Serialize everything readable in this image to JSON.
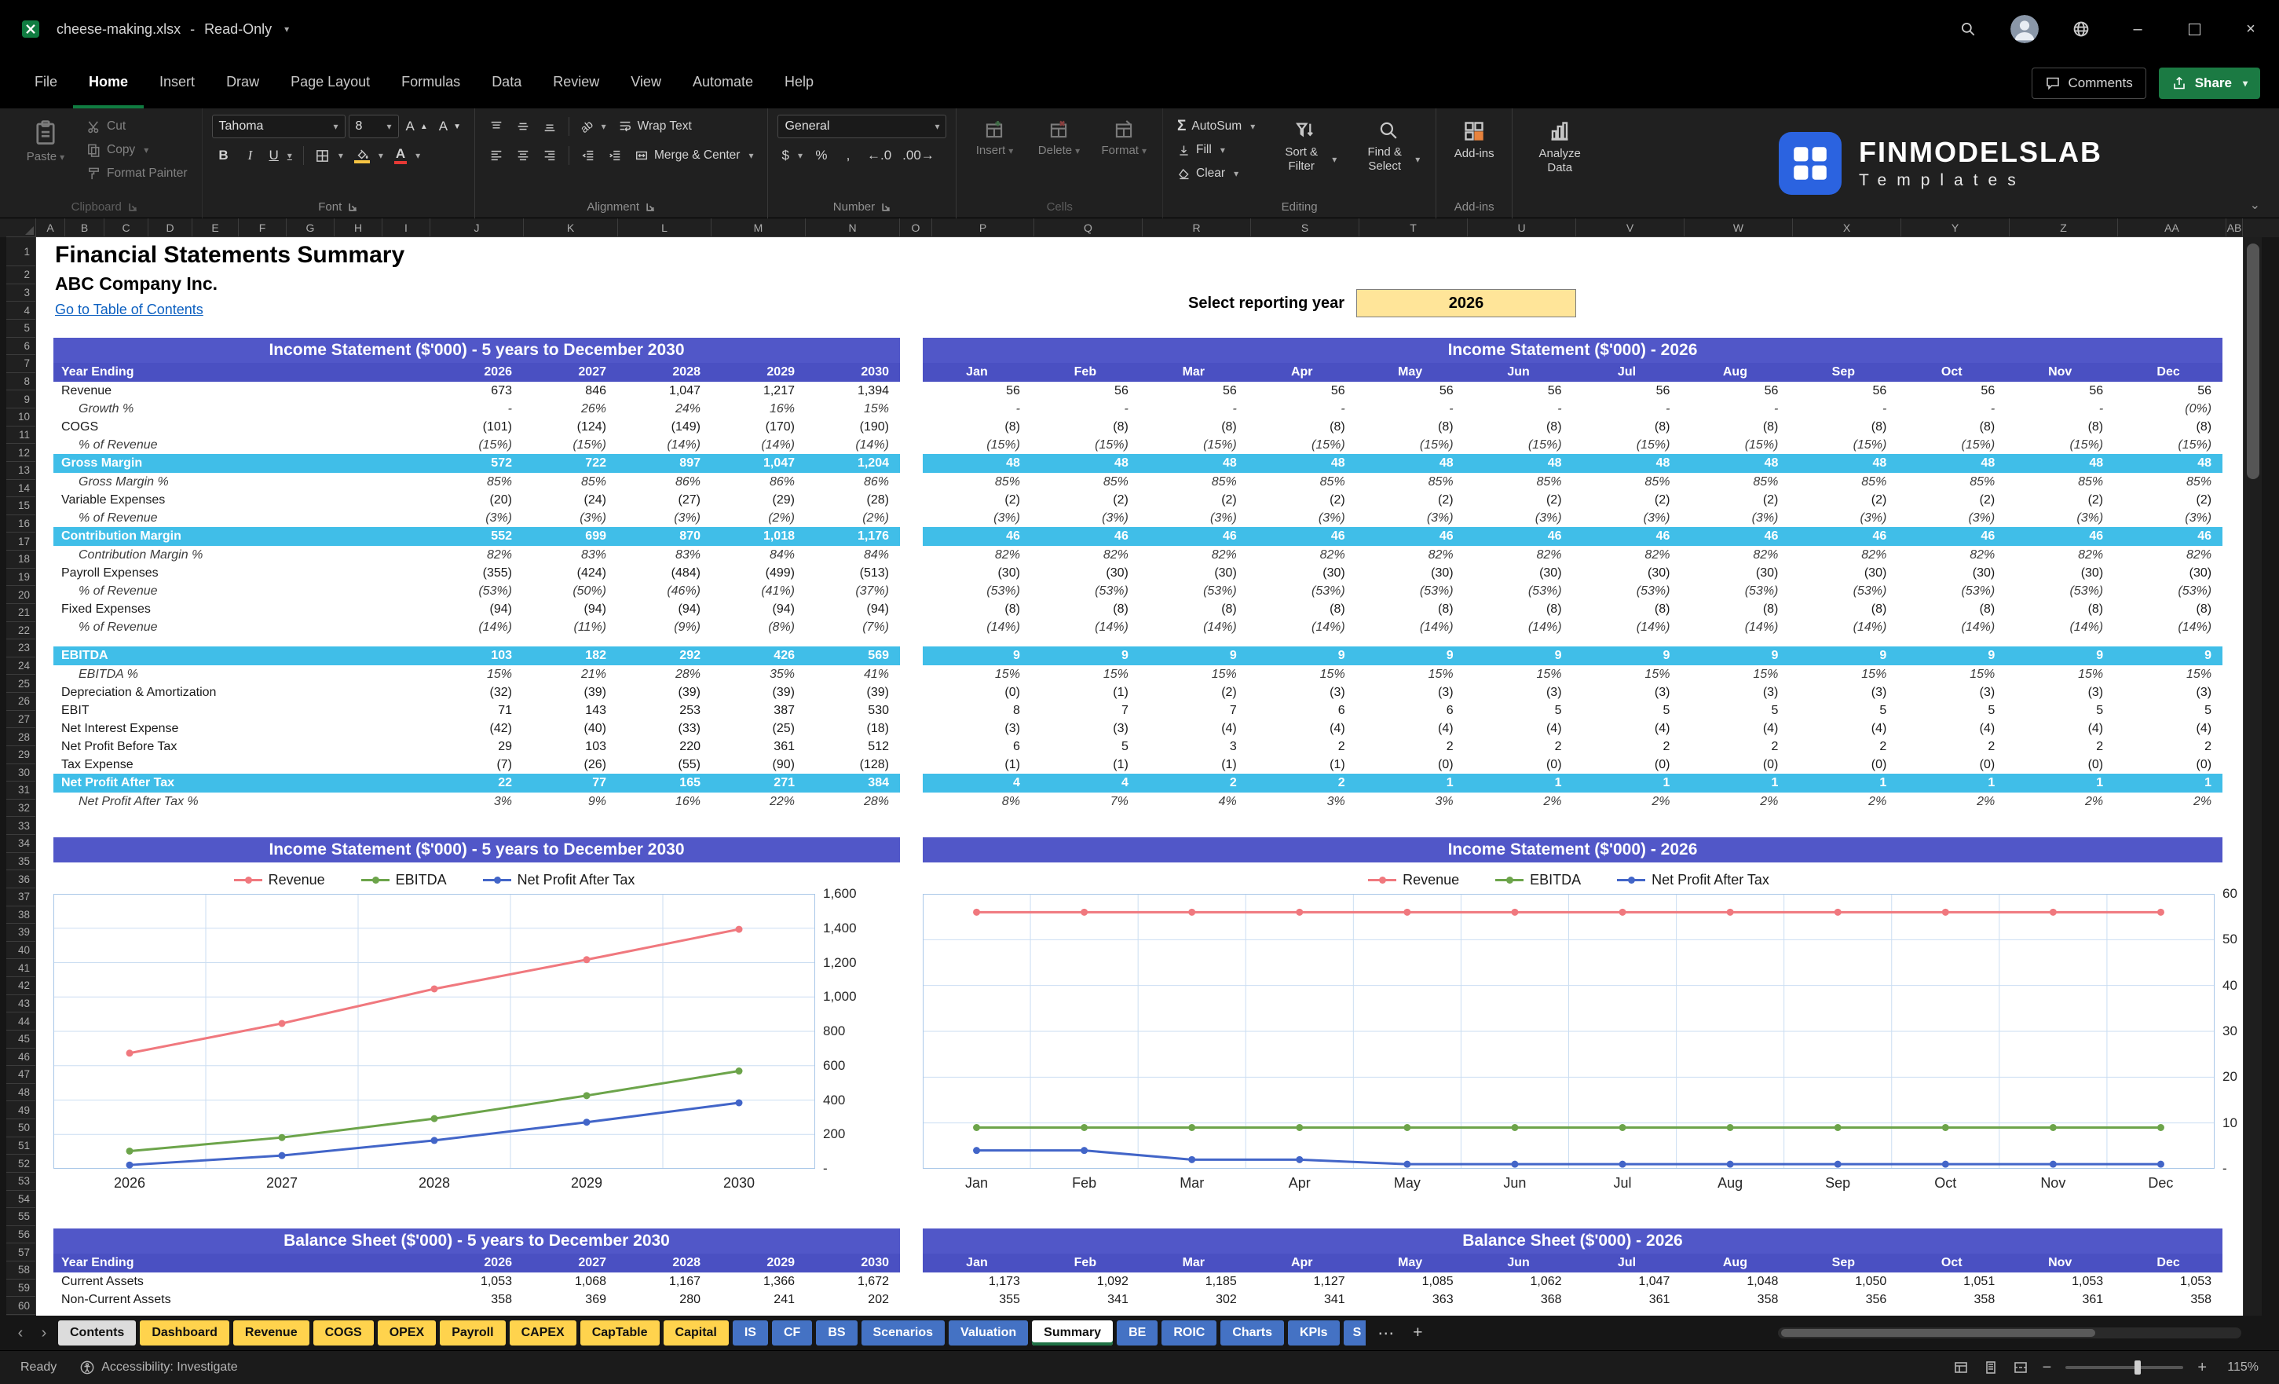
{
  "window": {
    "filename": "cheese-making.xlsx",
    "separator": "-",
    "mode": "Read-Only"
  },
  "menu": {
    "tabs": [
      "File",
      "Home",
      "Insert",
      "Draw",
      "Page Layout",
      "Formulas",
      "Data",
      "Review",
      "View",
      "Automate",
      "Help"
    ],
    "active_tab": "Home",
    "comments": "Comments",
    "share": "Share"
  },
  "ribbon": {
    "font_name": "Tahoma",
    "font_size": "8",
    "number_format": "General",
    "clipboard": {
      "label": "Clipboard",
      "paste": "Paste",
      "cut": "Cut",
      "copy": "Copy",
      "format_painter": "Format Painter"
    },
    "font": {
      "label": "Font",
      "bold": "B",
      "italic": "I",
      "underline": "U",
      "letter": "A",
      "orientation": "ab"
    },
    "alignment": {
      "label": "Alignment",
      "wrap_text": "Wrap Text",
      "merge_center": "Merge & Center"
    },
    "number": {
      "label": "Number",
      "currency": "$",
      "percent": "%",
      "comma": ",",
      "increase_decimal_icon": "←.0",
      "decrease_decimal_icon": ".00→"
    },
    "cells": {
      "label": "Cells",
      "insert": "Insert",
      "delete": "Delete",
      "format": "Format"
    },
    "editing": {
      "label": "Editing",
      "autosum_icon": "Σ",
      "autosum": "AutoSum",
      "fill": "Fill",
      "clear": "Clear",
      "sort_filter": "Sort & Filter",
      "find_select": "Find & Select"
    },
    "addins": {
      "label": "Add-ins",
      "addins": "Add-ins",
      "analyze": "Analyze Data"
    }
  },
  "logo": {
    "title": "FINMODELSLAB",
    "subtitle": "Templates"
  },
  "sheet": {
    "columns": [
      "A",
      "B",
      "C",
      "D",
      "E",
      "F",
      "G",
      "H",
      "I",
      "J",
      "K",
      "L",
      "M",
      "N",
      "O",
      "P",
      "Q",
      "R",
      "S",
      "T",
      "U",
      "V",
      "W",
      "X",
      "Y",
      "Z",
      "AA",
      "AB"
    ],
    "row_count": 60
  },
  "header_area": {
    "title": "Financial Statements Summary",
    "company": "ABC Company Inc.",
    "toc_link": "Go to Table of Contents",
    "select_label": "Select reporting year",
    "selected_year": "2026"
  },
  "colors": {
    "header_purple": "#5157C8",
    "row_header_purple": "#4A50C2",
    "highlight_cyan": "#40BEE8",
    "input_yellow": "#FFE599",
    "tab_yellow": "#FFD34D",
    "tab_blue": "#4472C4",
    "link_blue": "#0B5FC0",
    "share_green": "#1B7A43"
  },
  "income_annual": {
    "title": "Income Statement ($'000) - 5 years to December 2030",
    "header": [
      "Year Ending",
      "2026",
      "2027",
      "2028",
      "2029",
      "2030"
    ],
    "rows": [
      {
        "label": "Revenue",
        "style": "n",
        "values": [
          "673",
          "846",
          "1,047",
          "1,217",
          "1,394"
        ]
      },
      {
        "label": "Growth %",
        "style": "p",
        "values": [
          "-",
          "26%",
          "24%",
          "16%",
          "15%"
        ]
      },
      {
        "label": "COGS",
        "style": "n",
        "values": [
          "(101)",
          "(124)",
          "(149)",
          "(170)",
          "(190)"
        ]
      },
      {
        "label": "% of Revenue",
        "style": "p",
        "values": [
          "(15%)",
          "(15%)",
          "(14%)",
          "(14%)",
          "(14%)"
        ]
      },
      {
        "label": "Gross Margin",
        "style": "h",
        "values": [
          "572",
          "722",
          "897",
          "1,047",
          "1,204"
        ]
      },
      {
        "label": "Gross Margin %",
        "style": "p",
        "values": [
          "85%",
          "85%",
          "86%",
          "86%",
          "86%"
        ]
      },
      {
        "label": "Variable Expenses",
        "style": "n",
        "values": [
          "(20)",
          "(24)",
          "(27)",
          "(29)",
          "(28)"
        ]
      },
      {
        "label": "% of Revenue",
        "style": "p",
        "values": [
          "(3%)",
          "(3%)",
          "(3%)",
          "(2%)",
          "(2%)"
        ]
      },
      {
        "label": "Contribution Margin",
        "style": "h",
        "values": [
          "552",
          "699",
          "870",
          "1,018",
          "1,176"
        ]
      },
      {
        "label": "Contribution Margin %",
        "style": "p",
        "values": [
          "82%",
          "83%",
          "83%",
          "84%",
          "84%"
        ]
      },
      {
        "label": "Payroll Expenses",
        "style": "n",
        "values": [
          "(355)",
          "(424)",
          "(484)",
          "(499)",
          "(513)"
        ]
      },
      {
        "label": "% of Revenue",
        "style": "p",
        "values": [
          "(53%)",
          "(50%)",
          "(46%)",
          "(41%)",
          "(37%)"
        ]
      },
      {
        "label": "Fixed Expenses",
        "style": "n",
        "values": [
          "(94)",
          "(94)",
          "(94)",
          "(94)",
          "(94)"
        ]
      },
      {
        "label": "% of Revenue",
        "style": "p",
        "values": [
          "(14%)",
          "(11%)",
          "(9%)",
          "(8%)",
          "(7%)"
        ]
      },
      {
        "style": "s",
        "values": []
      },
      {
        "label": "EBITDA",
        "style": "h",
        "values": [
          "103",
          "182",
          "292",
          "426",
          "569"
        ]
      },
      {
        "label": "EBITDA %",
        "style": "p",
        "values": [
          "15%",
          "21%",
          "28%",
          "35%",
          "41%"
        ]
      },
      {
        "label": "Depreciation & Amortization",
        "style": "n",
        "values": [
          "(32)",
          "(39)",
          "(39)",
          "(39)",
          "(39)"
        ]
      },
      {
        "label": "EBIT",
        "style": "n",
        "values": [
          "71",
          "143",
          "253",
          "387",
          "530"
        ]
      },
      {
        "label": "Net Interest Expense",
        "style": "n",
        "values": [
          "(42)",
          "(40)",
          "(33)",
          "(25)",
          "(18)"
        ]
      },
      {
        "label": "Net Profit Before Tax",
        "style": "n",
        "values": [
          "29",
          "103",
          "220",
          "361",
          "512"
        ]
      },
      {
        "label": "Tax Expense",
        "style": "n",
        "values": [
          "(7)",
          "(26)",
          "(55)",
          "(90)",
          "(128)"
        ]
      },
      {
        "label": "Net Profit After Tax",
        "style": "h",
        "values": [
          "22",
          "77",
          "165",
          "271",
          "384"
        ]
      },
      {
        "label": "Net Profit After Tax %",
        "style": "p",
        "values": [
          "3%",
          "9%",
          "16%",
          "22%",
          "28%"
        ]
      }
    ]
  },
  "income_monthly": {
    "title": "Income Statement ($'000) - 2026",
    "columns": [
      "Jan",
      "Feb",
      "Mar",
      "Apr",
      "May",
      "Jun",
      "Jul",
      "Aug",
      "Sep",
      "Oct",
      "Nov",
      "Dec"
    ],
    "rows": [
      {
        "style": "n",
        "values": [
          "56",
          "56",
          "56",
          "56",
          "56",
          "56",
          "56",
          "56",
          "56",
          "56",
          "56",
          "56"
        ]
      },
      {
        "style": "p",
        "values": [
          "-",
          "-",
          "-",
          "-",
          "-",
          "-",
          "-",
          "-",
          "-",
          "-",
          "-",
          "(0%)"
        ]
      },
      {
        "style": "n",
        "values": [
          "(8)",
          "(8)",
          "(8)",
          "(8)",
          "(8)",
          "(8)",
          "(8)",
          "(8)",
          "(8)",
          "(8)",
          "(8)",
          "(8)"
        ]
      },
      {
        "style": "p",
        "values": [
          "(15%)",
          "(15%)",
          "(15%)",
          "(15%)",
          "(15%)",
          "(15%)",
          "(15%)",
          "(15%)",
          "(15%)",
          "(15%)",
          "(15%)",
          "(15%)"
        ]
      },
      {
        "style": "h",
        "values": [
          "48",
          "48",
          "48",
          "48",
          "48",
          "48",
          "48",
          "48",
          "48",
          "48",
          "48",
          "48"
        ]
      },
      {
        "style": "p",
        "values": [
          "85%",
          "85%",
          "85%",
          "85%",
          "85%",
          "85%",
          "85%",
          "85%",
          "85%",
          "85%",
          "85%",
          "85%"
        ]
      },
      {
        "style": "n",
        "values": [
          "(2)",
          "(2)",
          "(2)",
          "(2)",
          "(2)",
          "(2)",
          "(2)",
          "(2)",
          "(2)",
          "(2)",
          "(2)",
          "(2)"
        ]
      },
      {
        "style": "p",
        "values": [
          "(3%)",
          "(3%)",
          "(3%)",
          "(3%)",
          "(3%)",
          "(3%)",
          "(3%)",
          "(3%)",
          "(3%)",
          "(3%)",
          "(3%)",
          "(3%)"
        ]
      },
      {
        "style": "h",
        "values": [
          "46",
          "46",
          "46",
          "46",
          "46",
          "46",
          "46",
          "46",
          "46",
          "46",
          "46",
          "46"
        ]
      },
      {
        "style": "p",
        "values": [
          "82%",
          "82%",
          "82%",
          "82%",
          "82%",
          "82%",
          "82%",
          "82%",
          "82%",
          "82%",
          "82%",
          "82%"
        ]
      },
      {
        "style": "n",
        "values": [
          "(30)",
          "(30)",
          "(30)",
          "(30)",
          "(30)",
          "(30)",
          "(30)",
          "(30)",
          "(30)",
          "(30)",
          "(30)",
          "(30)"
        ]
      },
      {
        "style": "p",
        "values": [
          "(53%)",
          "(53%)",
          "(53%)",
          "(53%)",
          "(53%)",
          "(53%)",
          "(53%)",
          "(53%)",
          "(53%)",
          "(53%)",
          "(53%)",
          "(53%)"
        ]
      },
      {
        "style": "n",
        "values": [
          "(8)",
          "(8)",
          "(8)",
          "(8)",
          "(8)",
          "(8)",
          "(8)",
          "(8)",
          "(8)",
          "(8)",
          "(8)",
          "(8)"
        ]
      },
      {
        "style": "p",
        "values": [
          "(14%)",
          "(14%)",
          "(14%)",
          "(14%)",
          "(14%)",
          "(14%)",
          "(14%)",
          "(14%)",
          "(14%)",
          "(14%)",
          "(14%)",
          "(14%)"
        ]
      },
      {
        "style": "s",
        "values": []
      },
      {
        "style": "h",
        "values": [
          "9",
          "9",
          "9",
          "9",
          "9",
          "9",
          "9",
          "9",
          "9",
          "9",
          "9",
          "9"
        ]
      },
      {
        "style": "p",
        "values": [
          "15%",
          "15%",
          "15%",
          "15%",
          "15%",
          "15%",
          "15%",
          "15%",
          "15%",
          "15%",
          "15%",
          "15%"
        ]
      },
      {
        "style": "n",
        "values": [
          "(0)",
          "(1)",
          "(2)",
          "(3)",
          "(3)",
          "(3)",
          "(3)",
          "(3)",
          "(3)",
          "(3)",
          "(3)",
          "(3)"
        ]
      },
      {
        "style": "n",
        "values": [
          "8",
          "7",
          "7",
          "6",
          "6",
          "5",
          "5",
          "5",
          "5",
          "5",
          "5",
          "5"
        ]
      },
      {
        "style": "n",
        "values": [
          "(3)",
          "(3)",
          "(4)",
          "(4)",
          "(4)",
          "(4)",
          "(4)",
          "(4)",
          "(4)",
          "(4)",
          "(4)",
          "(4)"
        ]
      },
      {
        "style": "n",
        "values": [
          "6",
          "5",
          "3",
          "2",
          "2",
          "2",
          "2",
          "2",
          "2",
          "2",
          "2",
          "2"
        ]
      },
      {
        "style": "n",
        "values": [
          "(1)",
          "(1)",
          "(1)",
          "(1)",
          "(0)",
          "(0)",
          "(0)",
          "(0)",
          "(0)",
          "(0)",
          "(0)",
          "(0)"
        ]
      },
      {
        "style": "h",
        "values": [
          "4",
          "4",
          "2",
          "2",
          "1",
          "1",
          "1",
          "1",
          "1",
          "1",
          "1",
          "1"
        ]
      },
      {
        "style": "p",
        "values": [
          "8%",
          "7%",
          "4%",
          "3%",
          "3%",
          "2%",
          "2%",
          "2%",
          "2%",
          "2%",
          "2%",
          "2%"
        ]
      }
    ]
  },
  "balance_annual": {
    "title": "Balance Sheet ($'000) - 5 years to December 2030",
    "header": [
      "Year Ending",
      "2026",
      "2027",
      "2028",
      "2029",
      "2030"
    ],
    "rows": [
      {
        "label": "Current Assets",
        "style": "n",
        "values": [
          "1,053",
          "1,068",
          "1,167",
          "1,366",
          "1,672"
        ]
      },
      {
        "label": "Non-Current Assets",
        "style": "n",
        "values": [
          "358",
          "369",
          "280",
          "241",
          "202"
        ]
      }
    ]
  },
  "balance_monthly": {
    "title": "Balance Sheet ($'000) - 2026",
    "columns": [
      "Jan",
      "Feb",
      "Mar",
      "Apr",
      "May",
      "Jun",
      "Jul",
      "Aug",
      "Sep",
      "Oct",
      "Nov",
      "Dec"
    ],
    "rows": [
      {
        "style": "n",
        "values": [
          "1,173",
          "1,092",
          "1,185",
          "1,127",
          "1,085",
          "1,062",
          "1,047",
          "1,048",
          "1,050",
          "1,051",
          "1,053",
          "1,053"
        ]
      },
      {
        "style": "n",
        "values": [
          "355",
          "341",
          "302",
          "341",
          "363",
          "368",
          "361",
          "358",
          "356",
          "358",
          "361",
          "358"
        ]
      }
    ]
  },
  "chart_data": [
    {
      "type": "line",
      "title": "Income Statement ($'000) - 5 years to December 2030",
      "x": [
        "2026",
        "2027",
        "2028",
        "2029",
        "2030"
      ],
      "series": [
        {
          "name": "Revenue",
          "color": "#F0787E",
          "values": [
            673,
            846,
            1047,
            1217,
            1394
          ]
        },
        {
          "name": "EBITDA",
          "color": "#6CA44A",
          "values": [
            103,
            182,
            292,
            426,
            569
          ]
        },
        {
          "name": "Net Profit After Tax",
          "color": "#4265C8",
          "values": [
            22,
            77,
            165,
            271,
            384
          ]
        }
      ],
      "ylim": [
        0,
        1600
      ],
      "yticks": [
        "1,600",
        "1,400",
        "1,200",
        "1,000",
        "800",
        "600",
        "400",
        "200",
        "-"
      ],
      "legend_position": "top",
      "grid": true
    },
    {
      "type": "line",
      "title": "Income Statement ($'000) - 2026",
      "x": [
        "Jan",
        "Feb",
        "Mar",
        "Apr",
        "May",
        "Jun",
        "Jul",
        "Aug",
        "Sep",
        "Oct",
        "Nov",
        "Dec"
      ],
      "series": [
        {
          "name": "Revenue",
          "color": "#F0787E",
          "values": [
            56,
            56,
            56,
            56,
            56,
            56,
            56,
            56,
            56,
            56,
            56,
            56
          ]
        },
        {
          "name": "EBITDA",
          "color": "#6CA44A",
          "values": [
            9,
            9,
            9,
            9,
            9,
            9,
            9,
            9,
            9,
            9,
            9,
            9
          ]
        },
        {
          "name": "Net Profit After Tax",
          "color": "#4265C8",
          "values": [
            4,
            4,
            2,
            2,
            1,
            1,
            1,
            1,
            1,
            1,
            1,
            1
          ]
        }
      ],
      "ylim": [
        0,
        60
      ],
      "yticks": [
        "60",
        "50",
        "40",
        "30",
        "20",
        "10",
        "-"
      ],
      "legend_position": "top",
      "grid": true
    }
  ],
  "sheet_tabs": [
    {
      "label": "Contents",
      "style": "neutral"
    },
    {
      "label": "Dashboard",
      "style": "yellow"
    },
    {
      "label": "Revenue",
      "style": "yellow"
    },
    {
      "label": "COGS",
      "style": "yellow"
    },
    {
      "label": "OPEX",
      "style": "yellow"
    },
    {
      "label": "Payroll",
      "style": "yellow"
    },
    {
      "label": "CAPEX",
      "style": "yellow"
    },
    {
      "label": "CapTable",
      "style": "yellow"
    },
    {
      "label": "Capital",
      "style": "yellow"
    },
    {
      "label": "IS",
      "style": "blue"
    },
    {
      "label": "CF",
      "style": "blue"
    },
    {
      "label": "BS",
      "style": "blue"
    },
    {
      "label": "Scenarios",
      "style": "blue"
    },
    {
      "label": "Valuation",
      "style": "blue"
    },
    {
      "label": "Summary",
      "style": "active"
    },
    {
      "label": "BE",
      "style": "blue"
    },
    {
      "label": "ROIC",
      "style": "blue"
    },
    {
      "label": "Charts",
      "style": "blue"
    },
    {
      "label": "KPIs",
      "style": "blue"
    },
    {
      "label": "S",
      "style": "blue cut"
    }
  ],
  "status": {
    "ready": "Ready",
    "accessibility": "Accessibility: Investigate",
    "zoom": "115%"
  }
}
